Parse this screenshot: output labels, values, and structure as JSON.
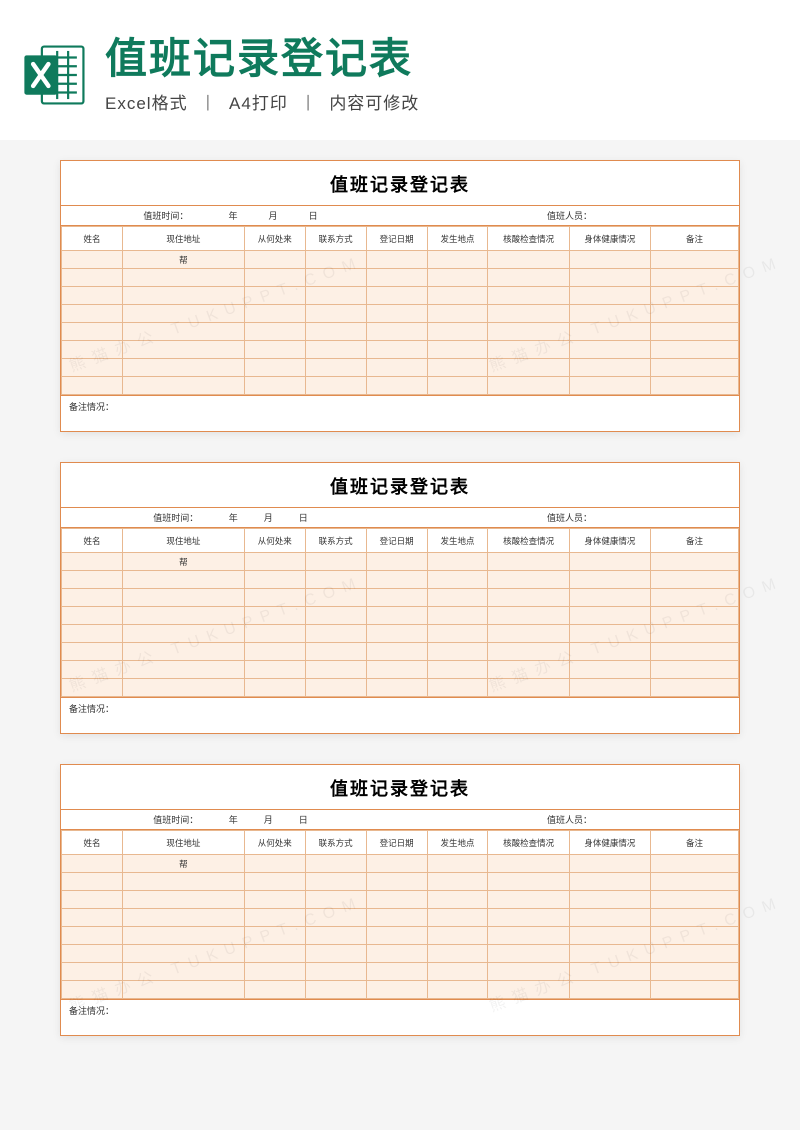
{
  "header": {
    "main_title": "值班记录登记表",
    "sub_format": "Excel格式",
    "sub_print": "A4打印",
    "sub_editable": "内容可修改",
    "icon_label": "excel-file-icon"
  },
  "sheet": {
    "title": "值班记录登记表",
    "meta": {
      "time_label": "值班时间：",
      "year": "年",
      "month": "月",
      "day": "日",
      "person_label": "值班人员："
    },
    "columns": [
      "姓名",
      "现住地址",
      "从何处来",
      "联系方式",
      "登记日期",
      "发生地点",
      "核酸检查情况",
      "身体健康情况",
      "备注"
    ],
    "sample_cell": "帮",
    "remarks_label": "备注情况："
  },
  "colors": {
    "brand_green": "#0f7a5c",
    "border_orange": "#e08b4f",
    "fill_peach": "#fdf0e5"
  },
  "watermark_text": "熊猫办公 TUKUPPT.COM"
}
